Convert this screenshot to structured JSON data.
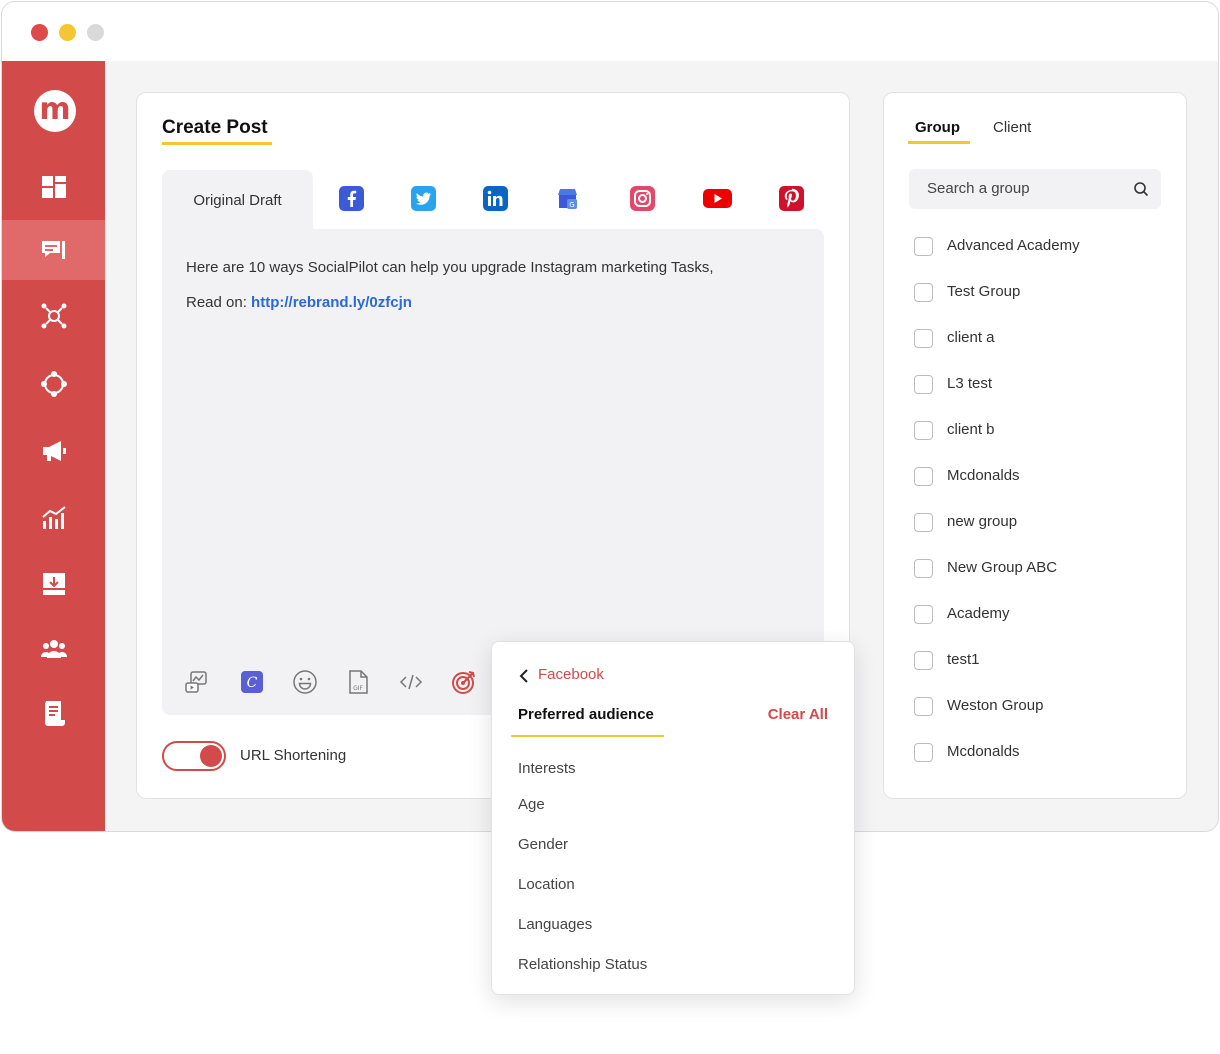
{
  "sidebar": {
    "logo": "m",
    "items": [
      {
        "name": "dashboard"
      },
      {
        "name": "posts"
      },
      {
        "name": "connections"
      },
      {
        "name": "workflow"
      },
      {
        "name": "campaigns"
      },
      {
        "name": "analytics"
      },
      {
        "name": "inbox"
      },
      {
        "name": "team"
      },
      {
        "name": "reports"
      }
    ]
  },
  "create_post": {
    "title": "Create Post",
    "tabs": {
      "original": "Original Draft",
      "networks": [
        "facebook-icon",
        "twitter-icon",
        "linkedin-icon",
        "google-business-icon",
        "instagram-icon",
        "youtube-icon",
        "pinterest-icon"
      ]
    },
    "content": {
      "line1": "Here are 10 ways SocialPilot can help you upgrade Instagram marketing Tasks,",
      "line2_prefix": "Read on: ",
      "link": "http://rebrand.ly/0zfcjn"
    },
    "toolbar": [
      "media-icon",
      "canva-icon",
      "emoji-icon",
      "gif-icon",
      "code-icon",
      "target-icon"
    ],
    "url_shortening": {
      "label": "URL Shortening",
      "enabled": true
    }
  },
  "groups": {
    "tabs": {
      "group": "Group",
      "client": "Client"
    },
    "search_placeholder": "Search a group",
    "items": [
      "Advanced Academy",
      "Test Group",
      "client a",
      "L3 test",
      "client b",
      "Mcdonalds",
      "new group",
      "New Group ABC",
      "Academy",
      "test1",
      "Weston Group",
      "Mcdonalds"
    ]
  },
  "audience_popup": {
    "back_label": "Facebook",
    "title": "Preferred audience",
    "clear_label": "Clear All",
    "items": [
      "Interests",
      "Age",
      "Gender",
      "Location",
      "Languages",
      "Relationship Status"
    ]
  },
  "colors": {
    "brand_red": "#d24a4a",
    "accent_yellow": "#f3c632",
    "link_blue": "#2a6ad6"
  }
}
